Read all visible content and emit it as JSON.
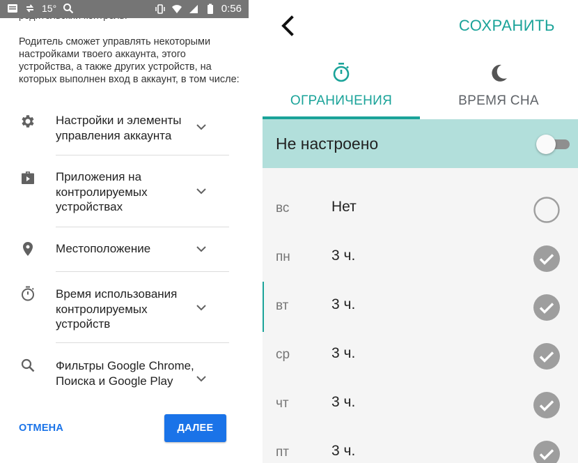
{
  "statusbar": {
    "temperature": "15°",
    "time": "0:56"
  },
  "left": {
    "clipped_text": "родительский контроль.",
    "intro": "Родитель сможет управлять некоторыми настройками твоего аккаунта, этого устройства, а также других устройств, на которых выполнен вход в аккаунт, в том числе:",
    "permissions": [
      {
        "label": "Настройки и элементы управления аккаунта",
        "icon": "gear-icon"
      },
      {
        "label": "Приложения на контролируемых устройствах",
        "icon": "app-briefcase-icon"
      },
      {
        "label": "Местоположение",
        "icon": "location-pin-icon"
      },
      {
        "label": "Время использования контролируемых устройств",
        "icon": "timer-icon"
      },
      {
        "label": "Фильтры Google Chrome, Поиска и Google Play",
        "icon": "search-icon"
      }
    ],
    "cancel_label": "ОТМЕНА",
    "next_label": "ДАЛЕЕ"
  },
  "right": {
    "save_label": "СОХРАНИТЬ",
    "tabs": [
      {
        "label": "ОГРАНИЧЕНИЯ",
        "icon": "timer-icon",
        "active": true
      },
      {
        "label": "ВРЕМЯ СНА",
        "icon": "moon-icon",
        "active": false
      }
    ],
    "status_label": "Не настроено",
    "toggle_on": false,
    "days": [
      {
        "day": "вс",
        "value": "Нет",
        "checked": false
      },
      {
        "day": "пн",
        "value": "3 ч.",
        "checked": true
      },
      {
        "day": "вт",
        "value": "3 ч.",
        "checked": true
      },
      {
        "day": "ср",
        "value": "3 ч.",
        "checked": true
      },
      {
        "day": "чт",
        "value": "3 ч.",
        "checked": true
      },
      {
        "day": "пт",
        "value": "3 ч.",
        "checked": true
      }
    ]
  },
  "colors": {
    "accent_teal": "#1aa399",
    "status_bg": "#b2dfdb",
    "primary_blue": "#1a73e8",
    "statusbar_gray": "#757575"
  }
}
